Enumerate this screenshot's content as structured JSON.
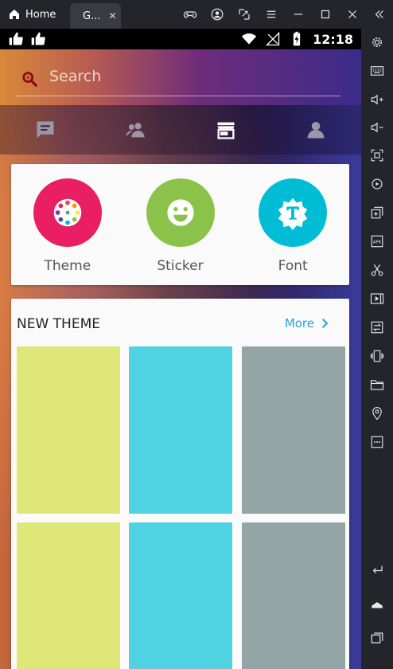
{
  "emulator": {
    "tabs": [
      {
        "label": "Home"
      },
      {
        "label": "G..."
      }
    ]
  },
  "statusbar": {
    "time": "12:18"
  },
  "search": {
    "placeholder": "Search"
  },
  "categories": [
    {
      "label": "Theme",
      "color": "#e91e63"
    },
    {
      "label": "Sticker",
      "color": "#8bc34a"
    },
    {
      "label": "Font",
      "color": "#00bcd4"
    }
  ],
  "new_theme": {
    "title": "NEW THEME",
    "more_label": "More",
    "tile_colors": [
      "#dfe678",
      "#4fd3e3",
      "#93a5a5",
      "#dfe678",
      "#4fd3e3",
      "#93a5a5"
    ]
  },
  "colors": {
    "accent": "#2aa3d8"
  }
}
